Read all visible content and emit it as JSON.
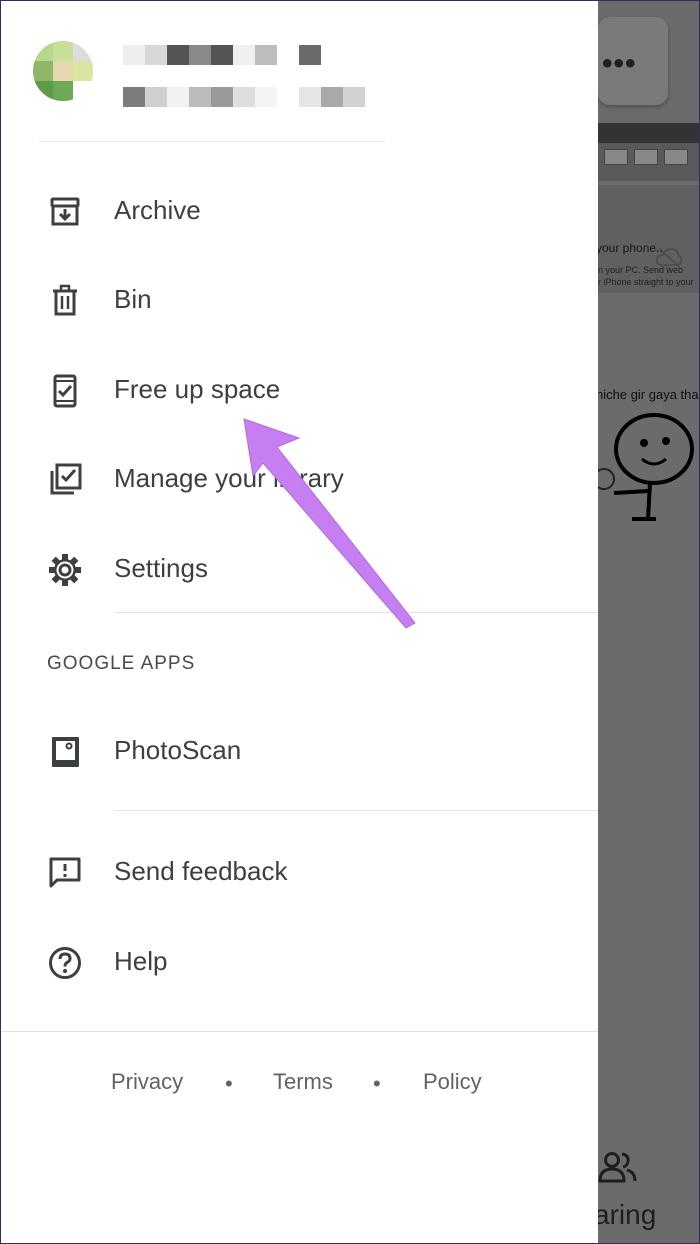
{
  "background": {
    "snippet_title": "your phone..",
    "snippet_line1": "n your PC. Send web",
    "snippet_line2": "r iPhone straight to your",
    "caption": "niche gir gaya tha.",
    "bottom_tab_label": "aring",
    "more_icon": "more-horiz-icon",
    "people_icon": "people-icon"
  },
  "menu": {
    "items": [
      {
        "label": "Archive",
        "icon": "archive-icon"
      },
      {
        "label": "Bin",
        "icon": "trash-icon"
      },
      {
        "label": "Free up space",
        "icon": "phone-check-icon"
      },
      {
        "label": "Manage your library",
        "icon": "library-check-icon"
      },
      {
        "label": "Settings",
        "icon": "gear-icon"
      }
    ],
    "section_title": "GOOGLE APPS",
    "apps": [
      {
        "label": "PhotoScan",
        "icon": "photoscan-icon"
      }
    ],
    "support": [
      {
        "label": "Send feedback",
        "icon": "feedback-icon"
      },
      {
        "label": "Help",
        "icon": "help-icon"
      }
    ]
  },
  "footer": {
    "privacy": "Privacy",
    "terms": "Terms",
    "policy": "Policy",
    "separator": "•"
  },
  "colors": {
    "text": "#3c4043",
    "annotation_arrow": "#c57ff0",
    "scrim": "#6b6b6b"
  }
}
